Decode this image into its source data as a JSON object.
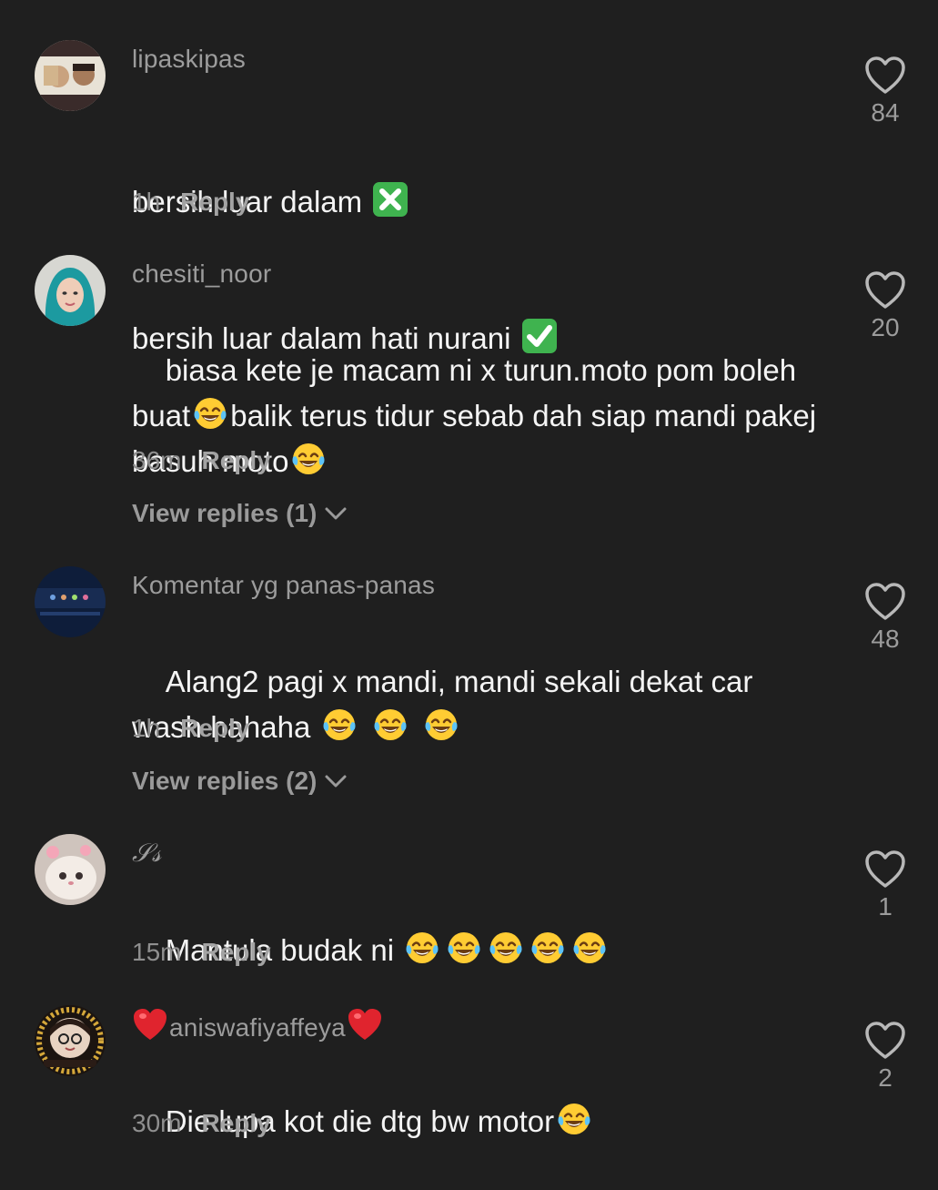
{
  "comments": [
    {
      "username": "lipaskipas",
      "line1": "bersih luar dalam ",
      "line2": "bersih luar dalam hati nurani ",
      "time": "1h",
      "reply": "Reply",
      "likes": "84"
    },
    {
      "username": "chesiti_noor",
      "part1": "biasa kete je macam ni x turun.moto pom boleh buat",
      "part2": "balik terus tidur sebab dah siap mandi pakej basuh moto",
      "time": "36m",
      "reply": "Reply",
      "view_replies": "View replies (1)",
      "likes": "20"
    },
    {
      "username": "Komentar yg panas-panas",
      "text": "Alang2 pagi x mandi, mandi sekali dekat car wash hahaha ",
      "time": "1h",
      "reply": "Reply",
      "view_replies": "View replies (2)",
      "likes": "48"
    },
    {
      "username": "𝒮𝓈",
      "text": "Mantula budak ni ",
      "time": "15m",
      "reply": "Reply",
      "likes": "1"
    },
    {
      "username": "aniswafiyaffeya",
      "text": "Die lupa kot die dtg bw motor",
      "time": "30m",
      "reply": "Reply",
      "likes": "2"
    }
  ],
  "colors": {
    "background": "#1f1f1f",
    "username": "#9c9c9c",
    "text": "#f4f4f4",
    "meta": "#8f8f8f"
  },
  "icons": {
    "like": "heart-outline-icon",
    "cross": "cross-mark-emoji",
    "check": "check-mark-emoji",
    "laugh": "tears-of-joy-emoji",
    "heart": "red-heart-emoji",
    "chevron": "chevron-down-icon"
  }
}
